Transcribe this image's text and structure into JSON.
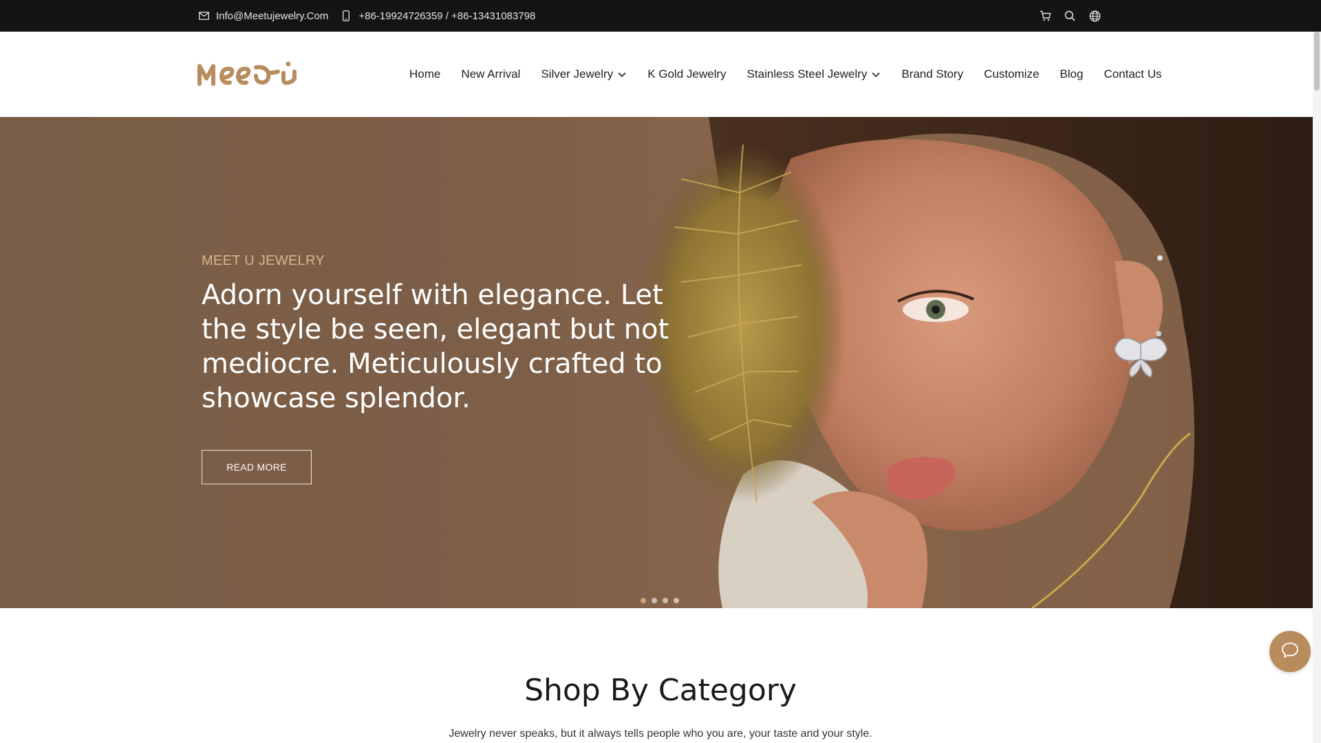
{
  "topbar": {
    "email": "Info@Meetujewelry.Com",
    "phone": "+86-19924726359 / +86-13431083798"
  },
  "header": {
    "logo_text": "Meeti",
    "nav": [
      {
        "label": "Home"
      },
      {
        "label": "New Arrival"
      },
      {
        "label": "Silver Jewelry",
        "dropdown": true
      },
      {
        "label": "K Gold Jewelry"
      },
      {
        "label": "Stainless Steel Jewelry",
        "dropdown": true
      },
      {
        "label": "Brand Story"
      },
      {
        "label": "Customize"
      },
      {
        "label": "Blog"
      },
      {
        "label": "Contact Us"
      }
    ]
  },
  "hero": {
    "eyebrow": "MEET U JEWELRY",
    "headline": "Adorn yourself with elegance. Let the style be seen, elegant but not mediocre. Meticulously crafted to showcase splendor.",
    "button_label": "READ MORE",
    "slides_total": 4,
    "active_slide": 1
  },
  "section": {
    "title": "Shop By Category",
    "subtitle": "Jewelry never speaks, but it always tells people who you are, your taste and your style."
  },
  "colors": {
    "topbar_bg": "#141414",
    "brand_gold": "#b98c5e",
    "hero_bg": "#7d5f48"
  },
  "icons": {
    "email": "envelope-icon",
    "phone": "phone-icon",
    "cart": "cart-icon",
    "search": "search-icon",
    "language": "globe-icon",
    "chat": "chat-bubble-icon",
    "dropdown": "chevron-down-icon"
  }
}
